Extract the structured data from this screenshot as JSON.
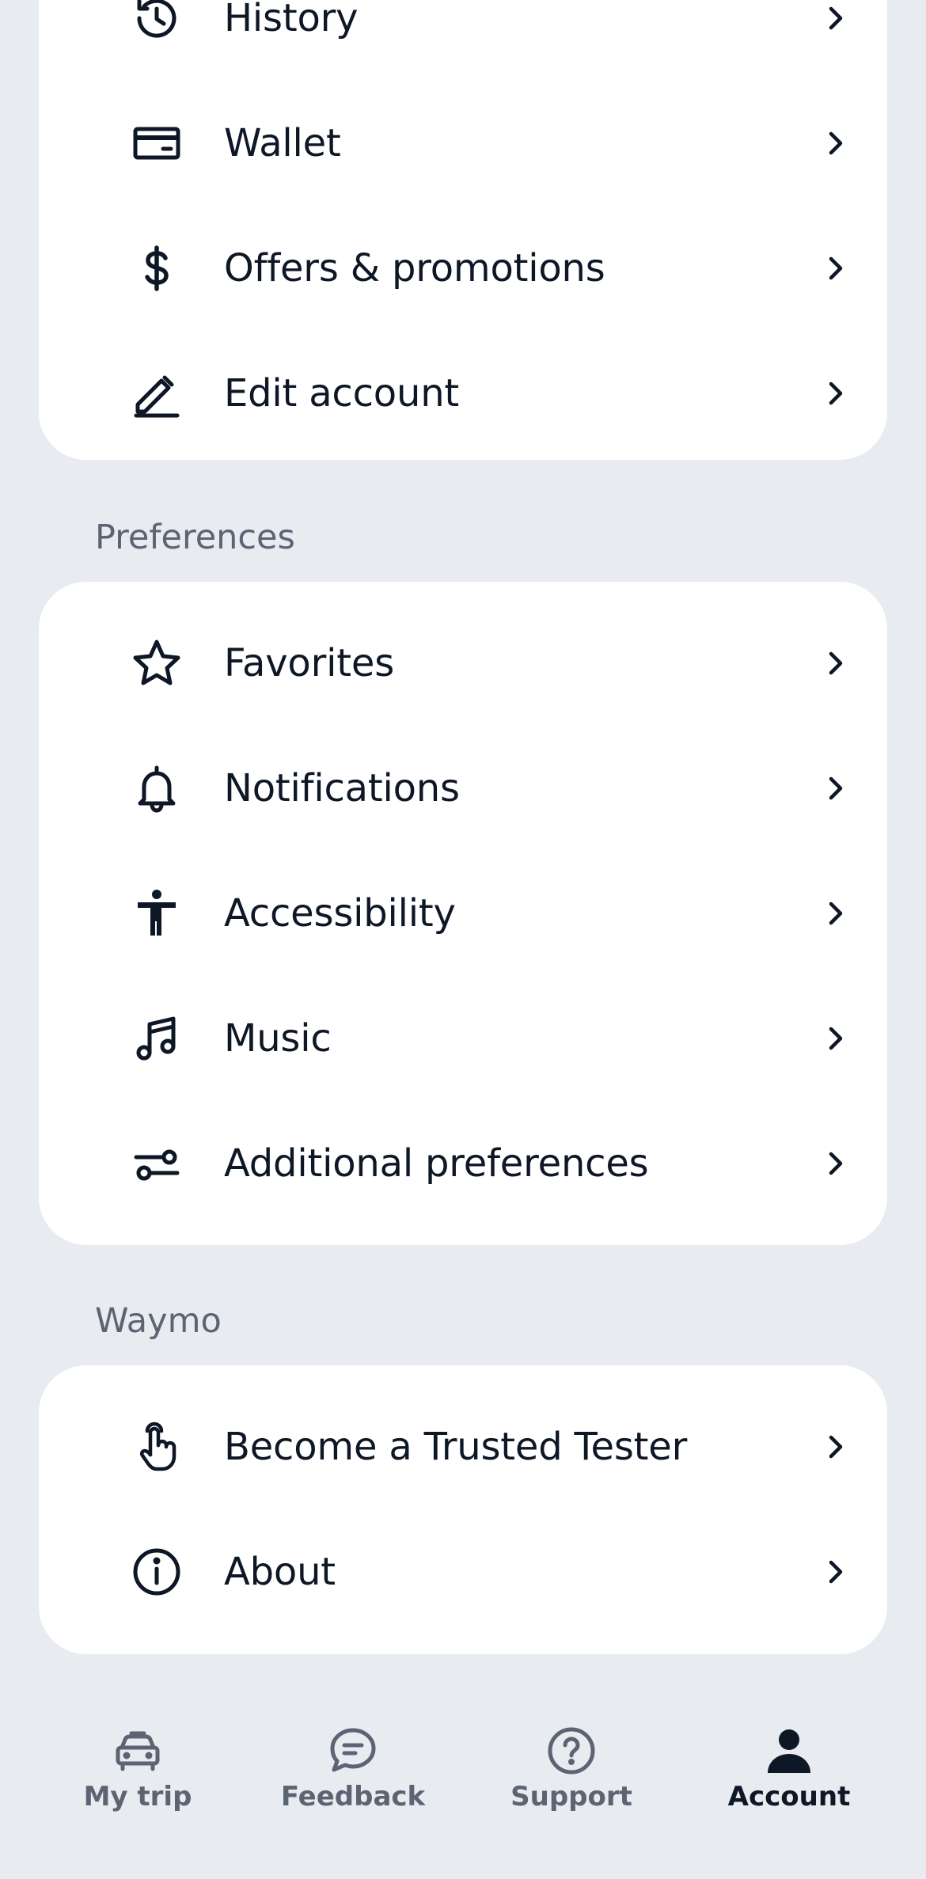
{
  "account_card": {
    "items": [
      {
        "label": "History",
        "icon": "history-icon"
      },
      {
        "label": "Wallet",
        "icon": "wallet-icon"
      },
      {
        "label": "Offers & promotions",
        "icon": "dollar-icon"
      },
      {
        "label": "Edit account",
        "icon": "pencil-icon"
      }
    ]
  },
  "preferences": {
    "title": "Preferences",
    "items": [
      {
        "label": "Favorites",
        "icon": "star-icon"
      },
      {
        "label": "Notifications",
        "icon": "bell-icon"
      },
      {
        "label": "Accessibility",
        "icon": "accessibility-icon"
      },
      {
        "label": "Music",
        "icon": "music-note-icon"
      },
      {
        "label": "Additional preferences",
        "icon": "sliders-icon"
      }
    ]
  },
  "waymo": {
    "title": "Waymo",
    "items": [
      {
        "label": "Become a Trusted Tester",
        "icon": "pointing-hand-icon"
      },
      {
        "label": "About",
        "icon": "info-icon"
      }
    ]
  },
  "tabbar": {
    "tabs": [
      {
        "label": "My trip",
        "icon": "car-icon",
        "active": false
      },
      {
        "label": "Feedback",
        "icon": "chat-bubble-icon",
        "active": false
      },
      {
        "label": "Support",
        "icon": "help-circle-icon",
        "active": false
      },
      {
        "label": "Account",
        "icon": "person-icon",
        "active": true
      }
    ]
  },
  "colors": {
    "background": "#e8ebf0",
    "card": "#ffffff",
    "text": "#0e1726",
    "secondary_text": "#5c6473"
  }
}
